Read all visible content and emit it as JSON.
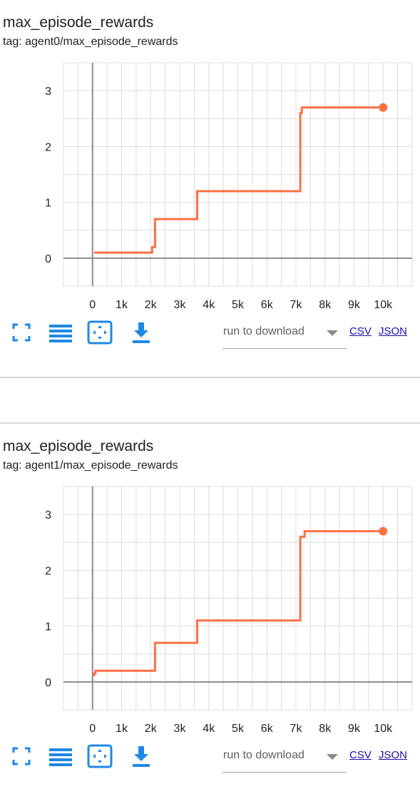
{
  "colors": {
    "series": "#ff7043",
    "grid": "#dcdcdc",
    "zero_line": "#8c8c8c",
    "icon": "#1e88e5",
    "link": "#1a0dab"
  },
  "icons": [
    "fullscreen-icon",
    "toggle-log-scale-icon",
    "fit-domain-icon",
    "download-icon"
  ],
  "cards": [
    {
      "title": "max_episode_rewards",
      "tag": "tag: agent0/max_episode_rewards",
      "run_select": {
        "label": "run to download",
        "selected": ""
      },
      "links": {
        "csv": "CSV",
        "json": "JSON"
      }
    },
    {
      "title": "max_episode_rewards",
      "tag": "tag: agent1/max_episode_rewards",
      "run_select": {
        "label": "run to download",
        "selected": ""
      },
      "links": {
        "csv": "CSV",
        "json": "JSON"
      }
    }
  ],
  "chart_data": [
    {
      "type": "line",
      "title": "max_episode_rewards",
      "xlabel": "",
      "ylabel": "",
      "xlim": [
        -1000,
        11000
      ],
      "ylim": [
        -0.5,
        3.5
      ],
      "grid": true,
      "x_ticks": [
        "0",
        "1k",
        "2k",
        "3k",
        "4k",
        "5k",
        "6k",
        "7k",
        "8k",
        "9k",
        "10k"
      ],
      "x_tick_values": [
        0,
        1000,
        2000,
        3000,
        4000,
        5000,
        6000,
        7000,
        8000,
        9000,
        10000
      ],
      "y_ticks": [
        "0",
        "1",
        "2",
        "3"
      ],
      "y_tick_values": [
        0,
        1,
        2,
        3
      ],
      "series": [
        {
          "x": [
            50,
            2050,
            2050,
            2150,
            2150,
            3600,
            3600,
            7150,
            7150,
            7200,
            7200,
            10000
          ],
          "y": [
            0.1,
            0.1,
            0.2,
            0.2,
            0.7,
            0.7,
            1.2,
            1.2,
            2.6,
            2.6,
            2.7,
            2.7
          ]
        }
      ]
    },
    {
      "type": "line",
      "title": "max_episode_rewards",
      "xlabel": "",
      "ylabel": "",
      "xlim": [
        -1000,
        11000
      ],
      "ylim": [
        -0.5,
        3.5
      ],
      "grid": true,
      "x_ticks": [
        "0",
        "1k",
        "2k",
        "3k",
        "4k",
        "5k",
        "6k",
        "7k",
        "8k",
        "9k",
        "10k"
      ],
      "x_tick_values": [
        0,
        1000,
        2000,
        3000,
        4000,
        5000,
        6000,
        7000,
        8000,
        9000,
        10000
      ],
      "y_ticks": [
        "0",
        "1",
        "2",
        "3"
      ],
      "y_tick_values": [
        0,
        1,
        2,
        3
      ],
      "series": [
        {
          "x": [
            50,
            50,
            100,
            100,
            2150,
            2150,
            3600,
            3600,
            7150,
            7150,
            7300,
            7300,
            10000
          ],
          "y": [
            0.1,
            0.15,
            0.15,
            0.2,
            0.2,
            0.7,
            0.7,
            1.1,
            1.1,
            2.6,
            2.6,
            2.7,
            2.7
          ]
        }
      ]
    }
  ]
}
